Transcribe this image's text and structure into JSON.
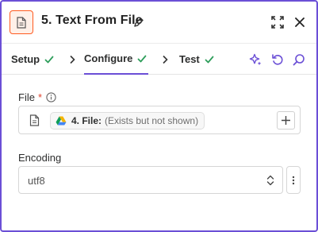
{
  "header": {
    "title": "5. Text From File",
    "app_icon": "file-text-icon",
    "accent_color": "#ff5a1f"
  },
  "steps": [
    {
      "label": "Setup",
      "done": true
    },
    {
      "label": "Configure",
      "done": true,
      "active": true
    },
    {
      "label": "Test",
      "done": true
    }
  ],
  "colors": {
    "brand": "#6b4fd6",
    "check": "#2e9e5b",
    "required": "#e0442f"
  },
  "form": {
    "file": {
      "label": "File",
      "required_mark": "*",
      "value_title": "4. File:",
      "value_note": "(Exists but not shown)",
      "value_source_icon": "google-drive-icon"
    },
    "encoding": {
      "label": "Encoding",
      "value": "utf8"
    }
  }
}
